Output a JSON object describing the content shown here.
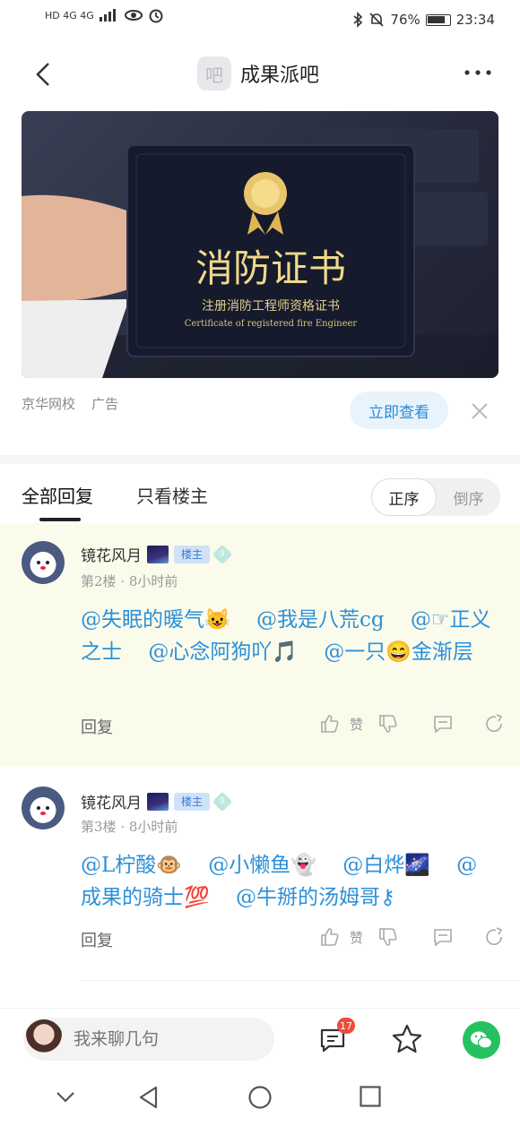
{
  "status_bar": {
    "left_text": "HD 4G 4G",
    "battery_percent": "76%",
    "time": "23:34"
  },
  "header": {
    "forum_avatar_text": "吧",
    "title": "成果派吧"
  },
  "ad": {
    "image_title": "消防证书",
    "image_subtitle": "注册消防工程师资格证书",
    "image_caption": "Certificate of registered fire Engineer",
    "source": "京华网校",
    "label": "广告",
    "cta": "立即查看"
  },
  "tabs": {
    "all_replies": "全部回复",
    "op_only": "只看楼主",
    "sort_asc": "正序",
    "sort_desc": "倒序",
    "selected_sort": "正序"
  },
  "posts": [
    {
      "username": "镜花风月",
      "op_badge": "楼主",
      "level": "9",
      "floor": "第2楼",
      "time": "8小时前",
      "mentions": [
        "@失眠的暖气😺",
        "@我是八荒cg",
        "@☞正义之士",
        "@心念阿狗吖🎵",
        "@一只😄金渐层"
      ],
      "reply_label": "回复",
      "like_label": "赞"
    },
    {
      "username": "镜花风月",
      "op_badge": "楼主",
      "level": "9",
      "floor": "第3楼",
      "time": "8小时前",
      "mentions": [
        "@L柠酸🐵",
        "@小懒鱼👻",
        "@白烨🌌",
        "@成果的骑士💯",
        "@牛掰的汤姆哥⚷"
      ],
      "reply_label": "回复",
      "like_label": "赞"
    }
  ],
  "bottom_bar": {
    "input_placeholder": "我来聊几句",
    "message_count": "17"
  },
  "colors": {
    "mention_blue": "#2b90d9",
    "highlight_bg": "#fbfbec",
    "badge_red": "#f04a3a",
    "wechat_green": "#25c160"
  }
}
